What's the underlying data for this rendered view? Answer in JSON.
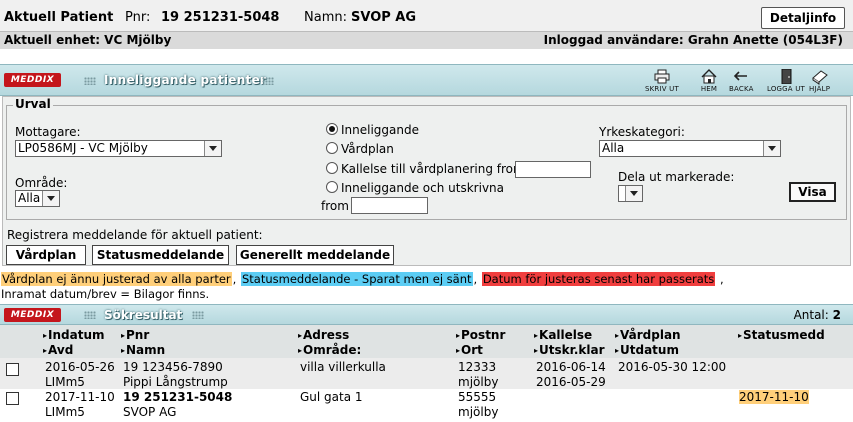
{
  "patient": {
    "label": "Aktuell Patient",
    "pnr_label": "Pnr:",
    "pnr": "19 251231-5048",
    "name_label": "Namn:",
    "name": "SVOP AG",
    "detalj_button": "Detaljinfo",
    "unit": "Aktuell enhet: VC Mjölby",
    "user": "Inloggad användare: Grahn Anette (054L3F)"
  },
  "module": {
    "logo": "MEDDIX",
    "title": "Inneliggande patienter",
    "tools": [
      {
        "label": "SKRIV UT",
        "icon": "printer-icon"
      },
      {
        "label": "HEM",
        "icon": "home-icon"
      },
      {
        "label": "BACKA",
        "icon": "back-arrow-icon"
      },
      {
        "label": "LOGGA UT",
        "icon": "logout-door-icon"
      },
      {
        "label": "HJÄLP",
        "icon": "help-book-icon"
      }
    ]
  },
  "urval": {
    "legend": "Urval",
    "mottagare_label": "Mottagare:",
    "mottagare_value": "LP0586MJ - VC Mjölby",
    "omrade_label": "Område:",
    "omrade_value": "Alla",
    "radios": [
      {
        "label": "Inneliggande",
        "checked": true
      },
      {
        "label": "Vårdplan",
        "checked": false
      },
      {
        "label": "Kallelse till vårdplanering from",
        "checked": false
      },
      {
        "label": "Inneliggande och utskrivna",
        "checked": false
      }
    ],
    "from_label": "from",
    "yrkeskategori_label": "Yrkeskategori:",
    "yrkeskategori_value": "Alla",
    "dela_label": "Dela ut markerade:",
    "dela_value": "",
    "visa_button": "Visa"
  },
  "register": {
    "label": "Registrera meddelande för aktuell patient:",
    "buttons": [
      "Vårdplan",
      "Statusmeddelande",
      "Generellt meddelande"
    ]
  },
  "legend": {
    "orange": "Vårdplan ej ännu justerad av alla parter",
    "blue": "Statusmeddelande - Sparat men ej sänt",
    "red": "Datum för justeras senast har passerats",
    "line2": "Inramat datum/brev = Bilagor finns.",
    "sep": ",",
    "trail": " ,"
  },
  "results": {
    "title": "Sökresultat",
    "antal_label": "Antal:",
    "antal": "2",
    "headers": {
      "indatum": "Indatum",
      "avd": "Avd",
      "pnr": "Pnr",
      "namn": "Namn",
      "adress": "Adress",
      "omrade": "Område:",
      "postnr": "Postnr",
      "ort": "Ort",
      "kallelse": "Kallelse",
      "utskr": "Utskr.klar",
      "vardplan": "Vårdplan",
      "utdatum": "Utdatum",
      "statusmedd": "Statusmedd"
    },
    "rows": [
      {
        "indatum": "2016-05-26",
        "avd": "LIMm5",
        "pnr": "19 123456-7890",
        "namn": "Pippi Långstrump",
        "adress": "villa villerkulla",
        "postnr": "12333",
        "ort": "mjölby",
        "kallelse": "2016-06-14",
        "utskr": "2016-05-29",
        "vardplan": "2016-05-30 12:00",
        "statusmedd": ""
      },
      {
        "indatum": "2017-11-10",
        "avd": "LIMm5",
        "pnr": "19 251231-5048",
        "namn": "SVOP AG",
        "adress": "Gul gata 1",
        "postnr": "55555",
        "ort": "mjölby",
        "kallelse": "",
        "utskr": "",
        "vardplan": "",
        "statusmedd": "2017-11-10"
      }
    ]
  },
  "colors": {
    "accent_red": "#c4161c",
    "bar_teal": "#b5d8de",
    "orange": "#ffcf7a",
    "blue": "#5ccdf4",
    "red": "#f03e3e"
  }
}
